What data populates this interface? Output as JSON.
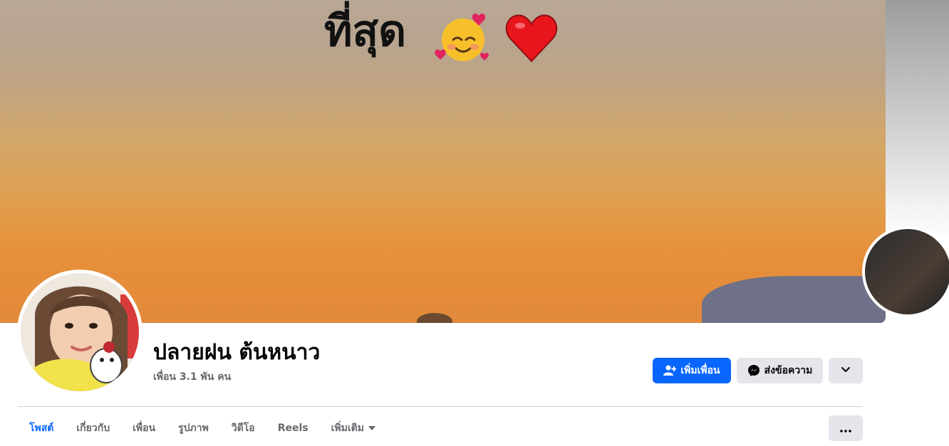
{
  "cover": {
    "text": "ที่สุด",
    "emojis": [
      "smiling-face-with-hearts",
      "red-heart"
    ]
  },
  "profile": {
    "name": "ปลายฝน ต้นหนาว",
    "friends": "เพื่อน 3.1 พัน คน"
  },
  "actions": {
    "add_friend": "เพิ่มเพื่อน",
    "message": "ส่งข้อความ",
    "more": "chevron-down-icon"
  },
  "tabs": [
    {
      "label": "โพสต์",
      "active": true
    },
    {
      "label": "เกี่ยวกับ",
      "active": false
    },
    {
      "label": "เพื่อน",
      "active": false
    },
    {
      "label": "รูปภาพ",
      "active": false
    },
    {
      "label": "วิดีโอ",
      "active": false
    },
    {
      "label": "Reels",
      "active": false
    },
    {
      "label": "เพิ่มเติม",
      "active": false
    }
  ],
  "colors": {
    "primary": "#0866ff",
    "secondary_bg": "#e4e6eb",
    "muted_text": "#65676b",
    "text": "#050505"
  }
}
